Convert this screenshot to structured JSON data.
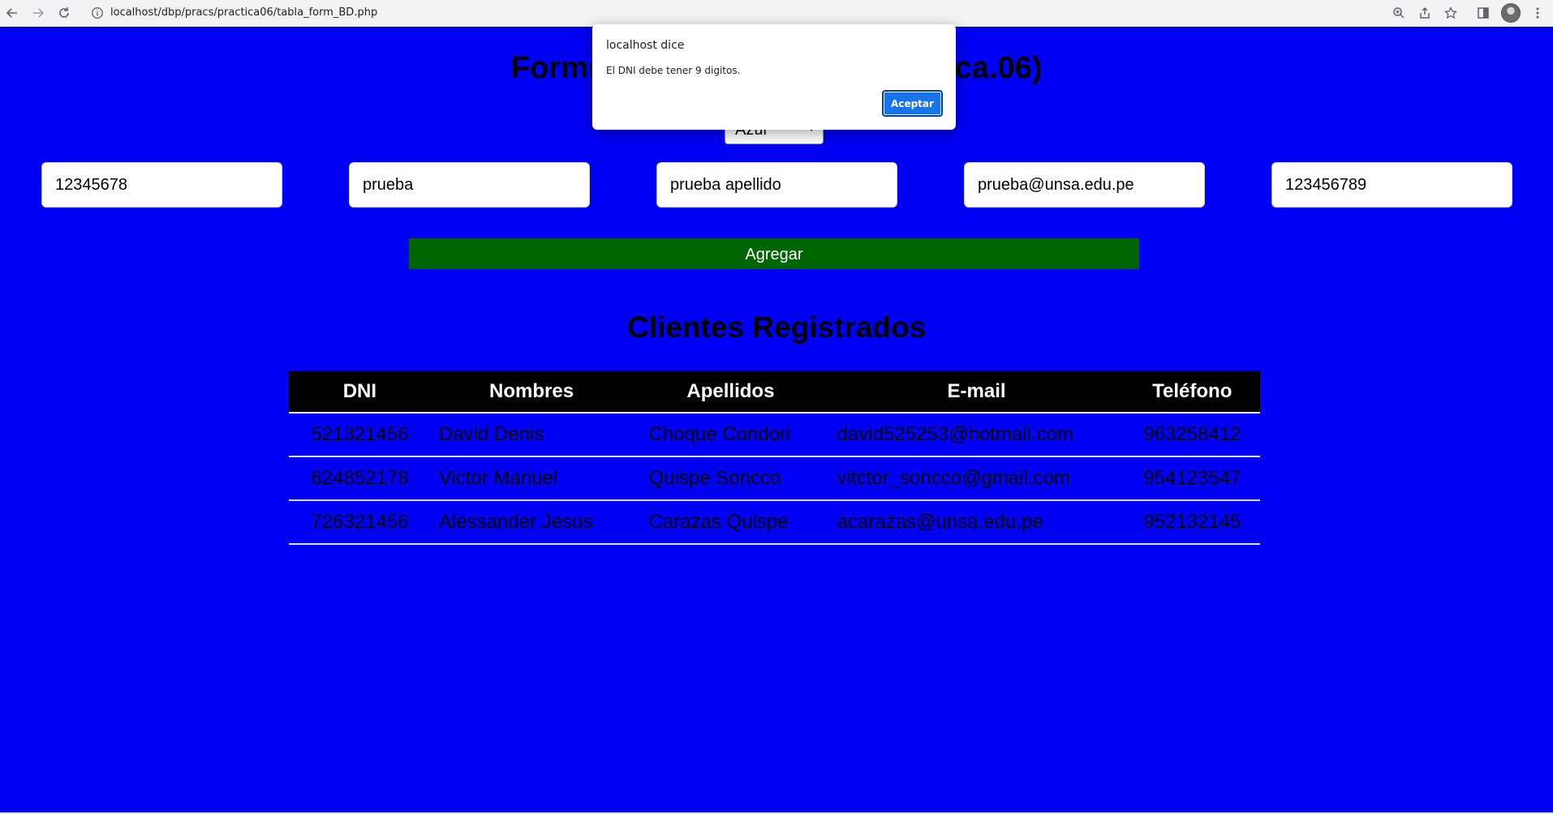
{
  "browser": {
    "url": "localhost/dbp/pracs/practica06/tabla_form_BD.php",
    "icons": [
      "back-icon",
      "forward-icon",
      "reload-icon",
      "info-icon",
      "zoom-icon",
      "share-icon",
      "star-icon",
      "sidepanel-icon",
      "menu-icon"
    ]
  },
  "page": {
    "title": "Formulario de Registro (Practica.06)",
    "color_select": {
      "selected": "Azul"
    },
    "background_color": "#0000f5"
  },
  "form": {
    "fields": [
      {
        "name": "dni",
        "value": "12345678"
      },
      {
        "name": "nombres",
        "value": "prueba"
      },
      {
        "name": "apellidos",
        "value": "prueba apellido"
      },
      {
        "name": "email",
        "value": "prueba@unsa.edu.pe"
      },
      {
        "name": "telefono",
        "value": "123456789"
      }
    ],
    "submit_label": "Agregar"
  },
  "clients": {
    "title": "Clientes Registrados",
    "headers": [
      "DNI",
      "Nombres",
      "Apellidos",
      "E-mail",
      "Teléfono"
    ],
    "rows": [
      [
        "521321456",
        "David Denis",
        "Choque Condori",
        "david525253@hotmail.com",
        "963258412"
      ],
      [
        "624852178",
        "Victor Manuel",
        "Quispe Soncco",
        "vitctor_soncco@gmail.com",
        "954123547"
      ],
      [
        "726321456",
        "Alessander Jesus",
        "Carazas Quispe",
        "acarazas@unsa.edu.pe",
        "952132145"
      ]
    ]
  },
  "dialog": {
    "title": "localhost dice",
    "message": "El DNI debe tener 9 digitos.",
    "button_label": "Aceptar"
  }
}
